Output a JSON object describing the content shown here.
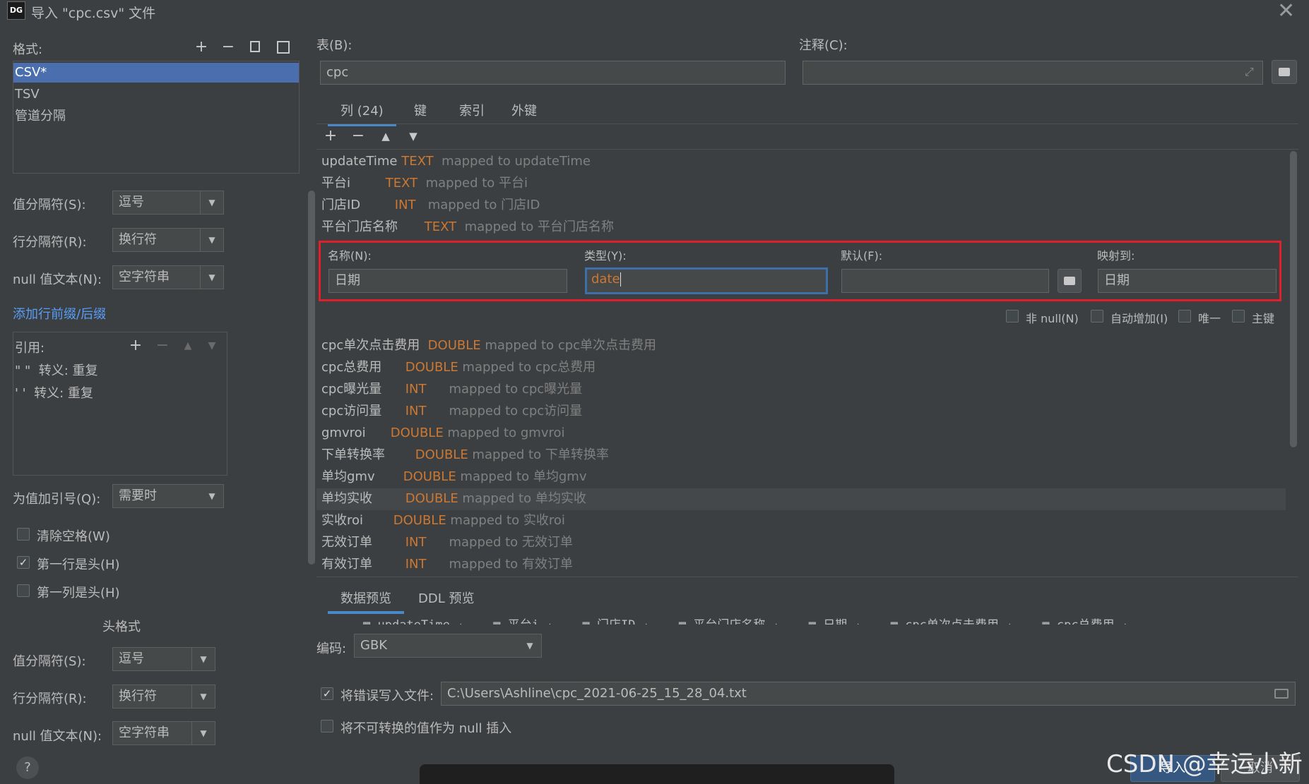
{
  "window": {
    "logo_text": "DG",
    "title": "导入 \"cpc.csv\" 文件",
    "close_label": "✕"
  },
  "left": {
    "format_label": "格式:",
    "formats": [
      "CSV*",
      "TSV",
      "管道分隔"
    ],
    "selected_format": "CSV*",
    "value_sep_label": "值分隔符(S):",
    "value_sep": "逗号",
    "row_sep_label": "行分隔符(R):",
    "row_sep": "换行符",
    "null_text_label": "null 值文本(N):",
    "null_text": "空字符串",
    "add_prefix_link": "添加行前缀/后缀",
    "quote_label": "引用:",
    "quotes": [
      {
        "char": "\" \"",
        "escape": "转义: 重复"
      },
      {
        "char": "' '",
        "escape": "转义: 重复"
      }
    ],
    "quote_values_label": "为值加引号(Q):",
    "quote_values": "需要时",
    "trim_label": "清除空格(W)",
    "trim_checked": false,
    "first_row_header_label": "第一行是头(H)",
    "first_row_header_checked": true,
    "first_col_header_label": "第一列是头(H)",
    "first_col_header_checked": false,
    "header_format_title": "头格式",
    "h_value_sep_label": "值分隔符(S):",
    "h_value_sep": "逗号",
    "h_row_sep_label": "行分隔符(R):",
    "h_row_sep": "换行符",
    "h_null_text_label": "null 值文本(N):",
    "h_null_text": "空字符串",
    "help": "?"
  },
  "right": {
    "table_label": "表(B):",
    "table_value": "cpc",
    "comment_label": "注释(C):",
    "comment_value": "",
    "tabs": [
      "列 (24)",
      "键",
      "索引",
      "外键"
    ],
    "active_tab": "列 (24)",
    "mapped_word": "mapped to",
    "columns_top": [
      {
        "name": "updateTime",
        "type": "TEXT",
        "target": "updateTime"
      },
      {
        "name": "平台i",
        "type": "TEXT",
        "target": "平台i"
      },
      {
        "name": "门店ID",
        "type": "INT",
        "target": "门店ID"
      },
      {
        "name": "平台门店名称",
        "type": "TEXT",
        "target": "平台门店名称"
      }
    ],
    "editor": {
      "name_label": "名称(N):",
      "name_value": "日期",
      "type_label": "类型(Y):",
      "type_value": "date",
      "default_label": "默认(F):",
      "default_value": "",
      "map_label": "映射到:",
      "map_value": "日期",
      "not_null_label": "非 null(N)",
      "auto_inc_label": "自动增加(I)",
      "unique_label": "唯一",
      "primary_label": "主键"
    },
    "columns_bottom": [
      {
        "name": "cpc单次点击费用",
        "type": "DOUBLE",
        "target": "cpc单次点击费用"
      },
      {
        "name": "cpc总费用",
        "type": "DOUBLE",
        "target": "cpc总费用"
      },
      {
        "name": "cpc曝光量",
        "type": "INT",
        "target": "cpc曝光量"
      },
      {
        "name": "cpc访问量",
        "type": "INT",
        "target": "cpc访问量"
      },
      {
        "name": "gmvroi",
        "type": "DOUBLE",
        "target": "gmvroi"
      },
      {
        "name": "下单转换率",
        "type": "DOUBLE",
        "target": "下单转换率"
      },
      {
        "name": "单均gmv",
        "type": "DOUBLE",
        "target": "单均gmv"
      },
      {
        "name": "单均实收",
        "type": "DOUBLE",
        "target": "单均实收"
      },
      {
        "name": "实收roi",
        "type": "DOUBLE",
        "target": "实收roi"
      },
      {
        "name": "无效订单",
        "type": "INT",
        "target": "无效订单"
      },
      {
        "name": "有效订单",
        "type": "INT",
        "target": "有效订单"
      }
    ],
    "preview_tabs": [
      "数据预览",
      "DDL 预览"
    ],
    "preview_columns": [
      "updateTime",
      "平台i",
      "门店ID",
      "平台门店名称",
      "日期",
      "cpc单次点击费用",
      "cpc总费用"
    ],
    "encoding_label": "编码:",
    "encoding_value": "GBK",
    "write_errors_label": "将错误写入文件:",
    "write_errors_checked": true,
    "error_file": "C:\\Users\\Ashline\\cpc_2021-06-25_15_28_04.txt",
    "null_insert_label": "将不可转换的值作为 null 插入",
    "null_insert_checked": false
  },
  "footer": {
    "import_label": "导入",
    "cancel_label": "取消"
  },
  "watermark": "CSDN @幸运小新",
  "colors": {
    "background": "#3c3f41",
    "selection": "#4b6eaf",
    "type_orange": "#cc7832",
    "link": "#589df6",
    "highlight_red": "#e0202a"
  }
}
